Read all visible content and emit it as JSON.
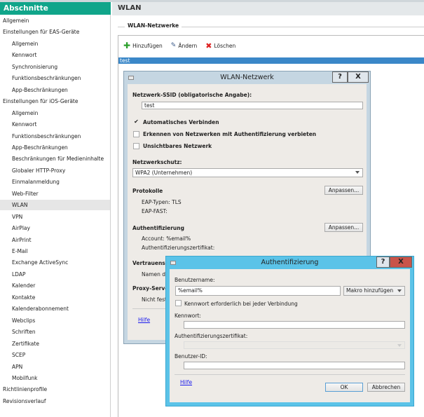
{
  "sidebar": {
    "title": "Abschnitte",
    "items": [
      {
        "label": "Allgemein",
        "level": 0
      },
      {
        "label": "Einstellungen für EAS-Geräte",
        "level": 0
      },
      {
        "label": "Allgemein",
        "level": 1
      },
      {
        "label": "Kennwort",
        "level": 1
      },
      {
        "label": "Synchronisierung",
        "level": 1
      },
      {
        "label": "Funktionsbeschränkungen",
        "level": 1
      },
      {
        "label": "App-Beschränkungen",
        "level": 1
      },
      {
        "label": "Einstellungen für iOS-Geräte",
        "level": 0
      },
      {
        "label": "Allgemein",
        "level": 1
      },
      {
        "label": "Kennwort",
        "level": 1
      },
      {
        "label": "Funktionsbeschränkungen",
        "level": 1
      },
      {
        "label": "App-Beschränkungen",
        "level": 1
      },
      {
        "label": "Beschränkungen für Medieninhalte",
        "level": 1
      },
      {
        "label": "Globaler HTTP-Proxy",
        "level": 1
      },
      {
        "label": "Einmalanmeldung",
        "level": 1
      },
      {
        "label": "Web-Filter",
        "level": 1
      },
      {
        "label": "WLAN",
        "level": 1,
        "selected": true
      },
      {
        "label": "VPN",
        "level": 1
      },
      {
        "label": "AirPlay",
        "level": 1
      },
      {
        "label": "AirPrint",
        "level": 1
      },
      {
        "label": "E-Mail",
        "level": 1
      },
      {
        "label": "Exchange ActiveSync",
        "level": 1
      },
      {
        "label": "LDAP",
        "level": 1
      },
      {
        "label": "Kalender",
        "level": 1
      },
      {
        "label": "Kontakte",
        "level": 1
      },
      {
        "label": "Kalenderabonnement",
        "level": 1
      },
      {
        "label": "Webclips",
        "level": 1
      },
      {
        "label": "Schriften",
        "level": 1
      },
      {
        "label": "Zertifikate",
        "level": 1
      },
      {
        "label": "SCEP",
        "level": 1
      },
      {
        "label": "APN",
        "level": 1
      },
      {
        "label": "Mobilfunk",
        "level": 1
      },
      {
        "label": "Richtlinienprofile",
        "level": 0
      },
      {
        "label": "Revisionsverlauf",
        "level": 0
      }
    ]
  },
  "main": {
    "title": "WLAN",
    "group": "WLAN-Netzwerke",
    "toolbar": {
      "add": "Hinzufügen",
      "edit": "Ändern",
      "delete": "Löschen"
    },
    "selected_row": "test"
  },
  "wlan_dialog": {
    "title": "WLAN-Netzwerk",
    "help_btn": "?",
    "close_btn": "X",
    "ssid_label": "Netzwerk-SSID (obligatorische Angabe):",
    "ssid_value": "test",
    "auto_connect": {
      "label": "Automatisches Verbinden",
      "checked": true
    },
    "block_captive": {
      "label": "Erkennen von Netzwerken mit Authentifizierung verbieten",
      "checked": false
    },
    "hidden": {
      "label": "Unsichtbares Netzwerk",
      "checked": false
    },
    "security_label": "Netzwerkschutz:",
    "security_value": "WPA2 (Unternehmen)",
    "protocols_label": "Protokolle",
    "customize": "Anpassen...",
    "eap_types": "EAP-Typen: TLS",
    "eap_fast": "EAP-FAST:",
    "auth_label": "Authentifizierung",
    "account": "Account: %email%",
    "auth_cert": "Authentifizierungszertifikat:",
    "trust_label": "Vertrauensw",
    "trust_names": "Namen de",
    "proxy_label": "Proxy-Serve",
    "proxy_value": "Nicht festg",
    "help_link": "Hilfe"
  },
  "auth_dialog": {
    "title": "Authentifizierung",
    "help_btn": "?",
    "close_btn": "X",
    "username_label": "Benutzername:",
    "username_value": "%email%",
    "macro": "Makro hinzufügen",
    "pw_each": {
      "label": "Kennwort erforderlich bei jeder Verbindung",
      "checked": false
    },
    "password_label": "Kennwort:",
    "cert_label": "Authentifizierungszertifikat:",
    "userid_label": "Benutzer-ID:",
    "help_link": "Hilfe",
    "ok": "OK",
    "cancel": "Abbrechen"
  },
  "colors": {
    "accent": "#10a58a",
    "selection": "#3a87c8",
    "dialog_frame": "#5bc3e8",
    "close_red": "#c9544a"
  }
}
